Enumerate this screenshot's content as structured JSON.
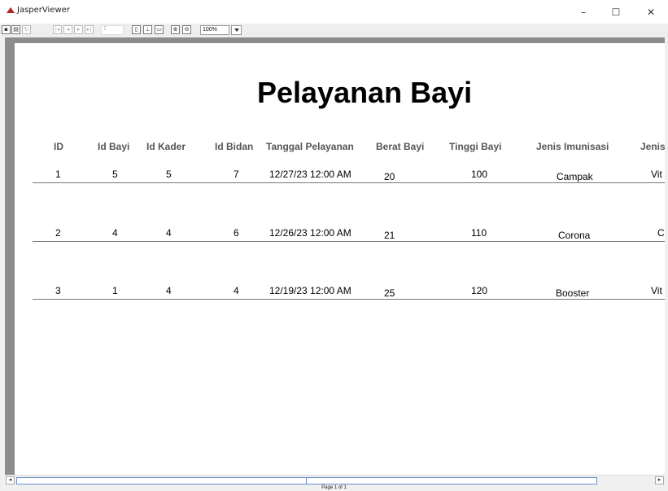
{
  "window": {
    "title": "JasperViewer",
    "minimize": "–",
    "maximize": "☐",
    "close": "✕"
  },
  "toolbar": {
    "page_number": "1",
    "zoom": "100%"
  },
  "report": {
    "title": "Pelayanan Bayi",
    "columns": [
      "ID",
      "Id Bayi",
      "Id Kader",
      "Id Bidan",
      "Tanggal Pelayanan",
      "Berat Bayi",
      "Tinggi Bayi",
      "Jenis Imunisasi",
      "Jenis"
    ],
    "rows": [
      [
        "1",
        "5",
        "5",
        "7",
        "12/27/23 12:00 AM",
        "20",
        "100",
        "Campak",
        "Vit"
      ],
      [
        "2",
        "4",
        "4",
        "6",
        "12/26/23 12:00 AM",
        "21",
        "110",
        "Corona",
        "C"
      ],
      [
        "3",
        "1",
        "4",
        "4",
        "12/19/23 12:00 AM",
        "25",
        "120",
        "Booster",
        "Vit"
      ]
    ]
  },
  "status": {
    "page_label": "Page 1 of 1"
  }
}
